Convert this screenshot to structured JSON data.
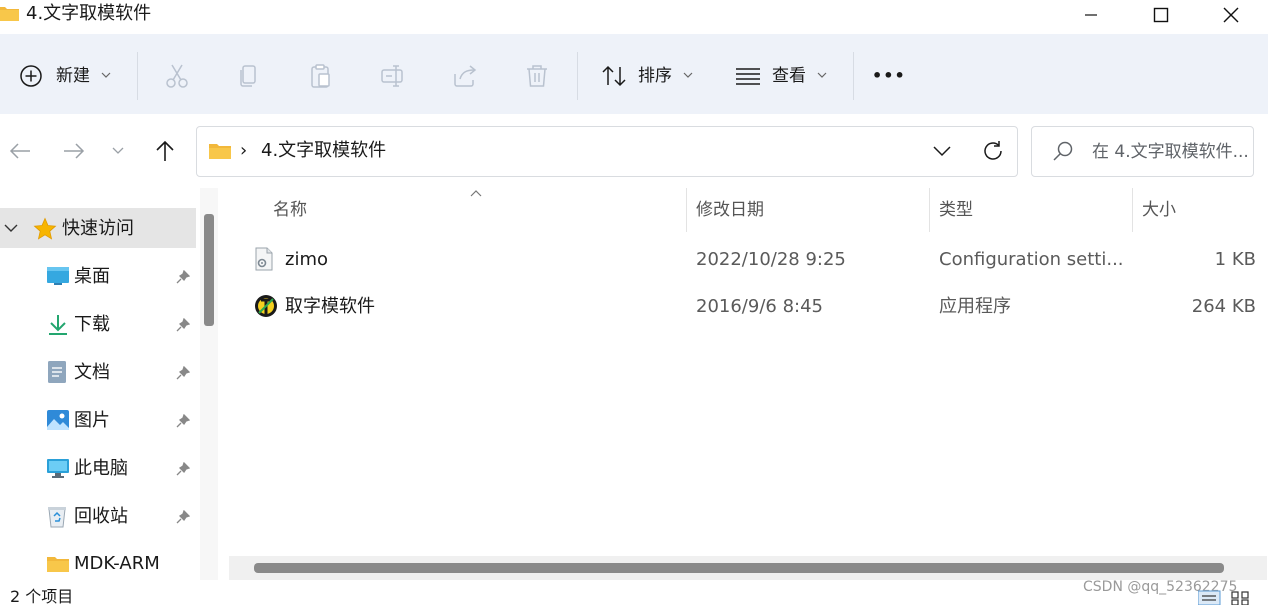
{
  "window": {
    "title": "4.文字取模软件"
  },
  "toolbar": {
    "new_label": "新建",
    "sort_label": "排序",
    "view_label": "查看",
    "more_label": "•••"
  },
  "address": {
    "separator": "›",
    "crumb": "4.文字取模软件",
    "search_placeholder": "在 4.文字取模软件..."
  },
  "nav": {
    "quick_access": "快速访问",
    "items": [
      {
        "label": "桌面",
        "icon": "desktop-icon",
        "pinned": true
      },
      {
        "label": "下载",
        "icon": "download-icon",
        "pinned": true
      },
      {
        "label": "文档",
        "icon": "document-icon",
        "pinned": true
      },
      {
        "label": "图片",
        "icon": "pictures-icon",
        "pinned": true
      },
      {
        "label": "此电脑",
        "icon": "computer-icon",
        "pinned": true
      },
      {
        "label": "回收站",
        "icon": "recycle-bin-icon",
        "pinned": true
      },
      {
        "label": "MDK-ARM",
        "icon": "folder-icon",
        "pinned": false
      }
    ]
  },
  "columns": {
    "name": "名称",
    "modified": "修改日期",
    "type": "类型",
    "size": "大小"
  },
  "files": [
    {
      "name": "zimo",
      "modified": "2022/10/28 9:25",
      "type": "Configuration setti...",
      "size": "1 KB",
      "icon": "config-file-icon"
    },
    {
      "name": "取字模软件",
      "modified": "2016/9/6 8:45",
      "type": "应用程序",
      "size": "264 KB",
      "icon": "application-icon"
    }
  ],
  "status": {
    "item_count": "2 个项目"
  },
  "watermark": "CSDN @qq_52362275",
  "colors": {
    "toolbar_bg": "#eef2f9",
    "accent": "#0067c0",
    "folder": "#f8c74a",
    "selected_nav_bg": "#e5e5e5"
  }
}
